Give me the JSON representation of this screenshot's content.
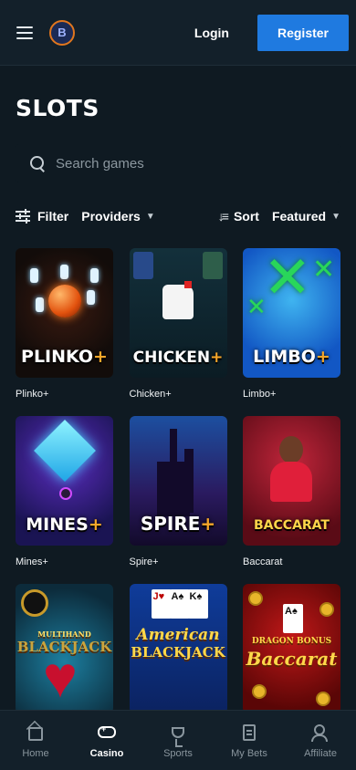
{
  "header": {
    "logo_text": "B",
    "login_label": "Login",
    "register_label": "Register"
  },
  "page": {
    "title": "SLOTS"
  },
  "search": {
    "placeholder": "Search games"
  },
  "filters": {
    "filter_label": "Filter",
    "providers_label": "Providers",
    "sort_label": "Sort",
    "sort_value": "Featured"
  },
  "games": [
    {
      "name": "Plinko+",
      "thumb_title": "PLINKO",
      "thumb_suffix": "+"
    },
    {
      "name": "Chicken+",
      "thumb_title": "CHICKEN",
      "thumb_suffix": "+"
    },
    {
      "name": "Limbo+",
      "thumb_title": "LIMBO",
      "thumb_suffix": "+"
    },
    {
      "name": "Mines+",
      "thumb_title": "MINES",
      "thumb_suffix": "+"
    },
    {
      "name": "Spire+",
      "thumb_title": "SPIRE",
      "thumb_suffix": "+"
    },
    {
      "name": "Baccarat",
      "thumb_title": "BACCARAT",
      "thumb_suffix": ""
    },
    {
      "name": "",
      "thumb_title": "BLACKJACK",
      "thumb_top": "MULTIHAND",
      "thumb_suffix": ""
    },
    {
      "name": "",
      "thumb_title": "BLACKJACK",
      "thumb_top": "American",
      "thumb_suffix": ""
    },
    {
      "name": "",
      "thumb_title": "Baccarat",
      "thumb_top": "DRAGON BONUS",
      "thumb_suffix": ""
    }
  ],
  "bottom_nav": [
    {
      "label": "Home",
      "icon": "home-icon"
    },
    {
      "label": "Casino",
      "icon": "gamepad-icon",
      "active": true
    },
    {
      "label": "Sports",
      "icon": "trophy-icon"
    },
    {
      "label": "My Bets",
      "icon": "bets-icon"
    },
    {
      "label": "Affiliate",
      "icon": "users-icon"
    }
  ],
  "colors": {
    "background": "#0f1a22",
    "header": "#13202a",
    "accent": "#1f7ae0",
    "plus_orange": "#f7a72a"
  }
}
